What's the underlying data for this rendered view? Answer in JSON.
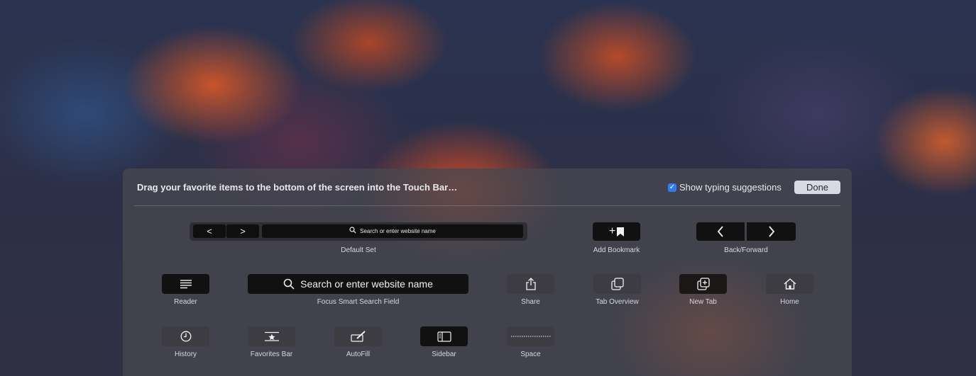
{
  "header": {
    "title": "Drag your favorite items to the bottom of the screen into the Touch Bar…",
    "show_suggestions_label": "Show typing suggestions",
    "show_suggestions_checked": true,
    "done_label": "Done"
  },
  "default_set": {
    "back_glyph": "<",
    "forward_glyph": ">",
    "search_placeholder": "Search or enter website name",
    "label": "Default Set"
  },
  "add_bookmark": {
    "glyph": "+",
    "label": "Add Bookmark"
  },
  "back_forward": {
    "back_glyph": "<",
    "forward_glyph": ">",
    "label": "Back/Forward"
  },
  "items_row2": [
    {
      "label": "Reader",
      "icon": "reader-icon"
    },
    {
      "label": "Focus Smart Search Field",
      "placeholder": "Search or enter website name",
      "icon": "search-icon"
    },
    {
      "label": "Share",
      "icon": "share-icon"
    },
    {
      "label": "Tab Overview",
      "icon": "tab-overview-icon"
    },
    {
      "label": "New Tab",
      "icon": "new-tab-icon"
    },
    {
      "label": "Home",
      "icon": "home-icon"
    }
  ],
  "items_row3": [
    {
      "label": "History",
      "icon": "clock-icon"
    },
    {
      "label": "Favorites Bar",
      "icon": "favorites-bar-icon"
    },
    {
      "label": "AutoFill",
      "icon": "autofill-icon"
    },
    {
      "label": "Sidebar",
      "icon": "sidebar-icon"
    },
    {
      "label": "Space",
      "icon": "space-icon"
    }
  ],
  "colors": {
    "accent": "#2f7df6",
    "panel": "#48484f",
    "touchbar_button": "#111111"
  }
}
